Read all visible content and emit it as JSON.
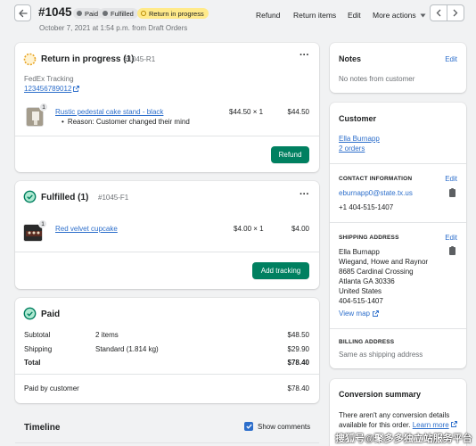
{
  "header": {
    "order_number": "#1045",
    "badges": [
      {
        "label": "Paid",
        "dot_color": "#6d7175",
        "bg": "#e4e5e7"
      },
      {
        "label": "Fulfilled",
        "dot_color": "#6d7175",
        "bg": "#e4e5e7"
      },
      {
        "label": "Return in progress",
        "dot_color": "#b98900",
        "bg": "#ffea8a"
      }
    ],
    "subtitle": "October 7, 2021 at 1:54 p.m. from Draft Orders",
    "actions": {
      "refund": "Refund",
      "return_items": "Return items",
      "edit": "Edit",
      "more_actions": "More actions"
    }
  },
  "return_card": {
    "title": "Return in progress (1)",
    "code": "#1045-R1",
    "carrier": "FedEx Tracking",
    "tracking_number": "123456789012",
    "item": {
      "name": "Rustic pedestal cake stand - black",
      "quantity": "1",
      "reason": "Reason: Customer changed their mind",
      "price": "$44.50 × 1",
      "total": "$44.50"
    },
    "action_button": "Refund"
  },
  "fulfilled_card": {
    "title": "Fulfilled (1)",
    "code": "#1045-F1",
    "item": {
      "name": "Red velvet cupcake",
      "quantity": "1",
      "price": "$4.00 × 1",
      "total": "$4.00"
    },
    "action_button": "Add tracking"
  },
  "paid_card": {
    "title": "Paid",
    "rows": [
      {
        "label": "Subtotal",
        "detail": "2 items",
        "amount": "$48.50"
      },
      {
        "label": "Shipping",
        "detail": "Standard (1.814 kg)",
        "amount": "$29.90"
      },
      {
        "label": "Total",
        "detail": "",
        "amount": "$78.40"
      }
    ],
    "paid_by_label": "Paid by customer",
    "paid_by_amount": "$78.40"
  },
  "timeline": {
    "title": "Timeline",
    "show_comments_label": "Show comments",
    "show_comments_checked": true
  },
  "notes_card": {
    "title": "Notes",
    "edit": "Edit",
    "empty_text": "No notes from customer"
  },
  "customer_card": {
    "title": "Customer",
    "name": "Ella Burnapp",
    "orders": "2 orders",
    "contact": {
      "heading": "CONTACT INFORMATION",
      "edit": "Edit",
      "email": "eburnapp0@state.tx.us",
      "phone": "+1 404-515-1407"
    },
    "shipping": {
      "heading": "SHIPPING ADDRESS",
      "edit": "Edit",
      "lines": [
        "Ella Burnapp",
        "Wiegand, Howe and Raynor",
        "8685 Cardinal Crossing",
        "Atlanta GA 30336",
        "United States",
        "404-515-1407"
      ],
      "view_map": "View map"
    },
    "billing": {
      "heading": "BILLING ADDRESS",
      "text": "Same as shipping address"
    }
  },
  "conversion_card": {
    "title": "Conversion summary",
    "text_line1": "There aren't any conversion details",
    "text_line2": "available for this order.",
    "learn_more": "Learn more"
  },
  "watermark": "搜狐号@聚多多独立站服务平台",
  "colors": {
    "primary": "#008060",
    "link": "#2c6ecb",
    "background": "#f1f2f3"
  }
}
